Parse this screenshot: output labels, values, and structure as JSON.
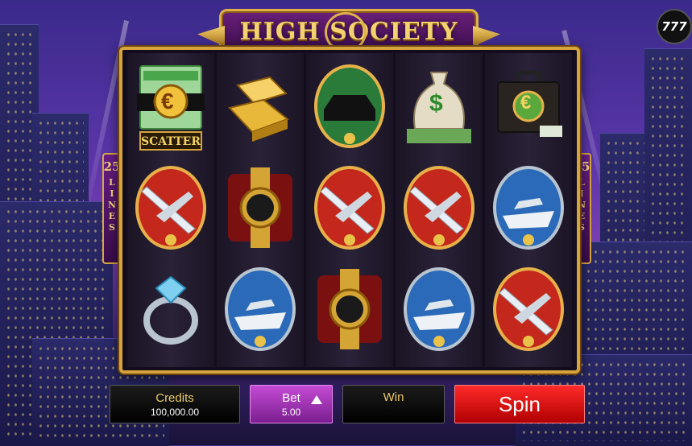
{
  "game": {
    "title": "HIGH SOCIETY",
    "badge": "777",
    "lines_left": {
      "number": "25",
      "word": "LINES"
    },
    "lines_right": {
      "number": "25",
      "word": "LINES"
    }
  },
  "reels": [
    [
      "scatter-cash-euro",
      "gold-bars",
      "limousine"
    ],
    [
      "private-jet",
      "gold-watch",
      "private-jet"
    ],
    [
      "diamond-ring",
      "yacht",
      "gold-watch"
    ]
  ],
  "reel_columns": [
    {
      "top": "scatter-cash-euro",
      "middle": "private-jet",
      "bottom": "diamond-ring"
    },
    {
      "top": "gold-bars",
      "middle": "gold-watch",
      "bottom": "yacht"
    },
    {
      "top": "limousine",
      "middle": "private-jet",
      "bottom": "gold-watch"
    },
    {
      "top": "money-bag",
      "middle": "private-jet",
      "bottom": "yacht"
    },
    {
      "top": "briefcase-euro",
      "middle": "yacht",
      "bottom": "private-jet"
    }
  ],
  "scatter_label": "SCATTER",
  "euro_symbol": "€",
  "dollar_symbol": "$",
  "controls": {
    "credits_label": "Credits",
    "credits_value": "100,000.00",
    "bet_label": "Bet",
    "bet_value": "5.00",
    "win_label": "Win",
    "win_value": "",
    "spin_label": "Spin"
  },
  "colors": {
    "gold": "#d6a43c",
    "purple": "#6a1e86",
    "spin_red": "#e01010",
    "bet_purple": "#a53ab8"
  }
}
